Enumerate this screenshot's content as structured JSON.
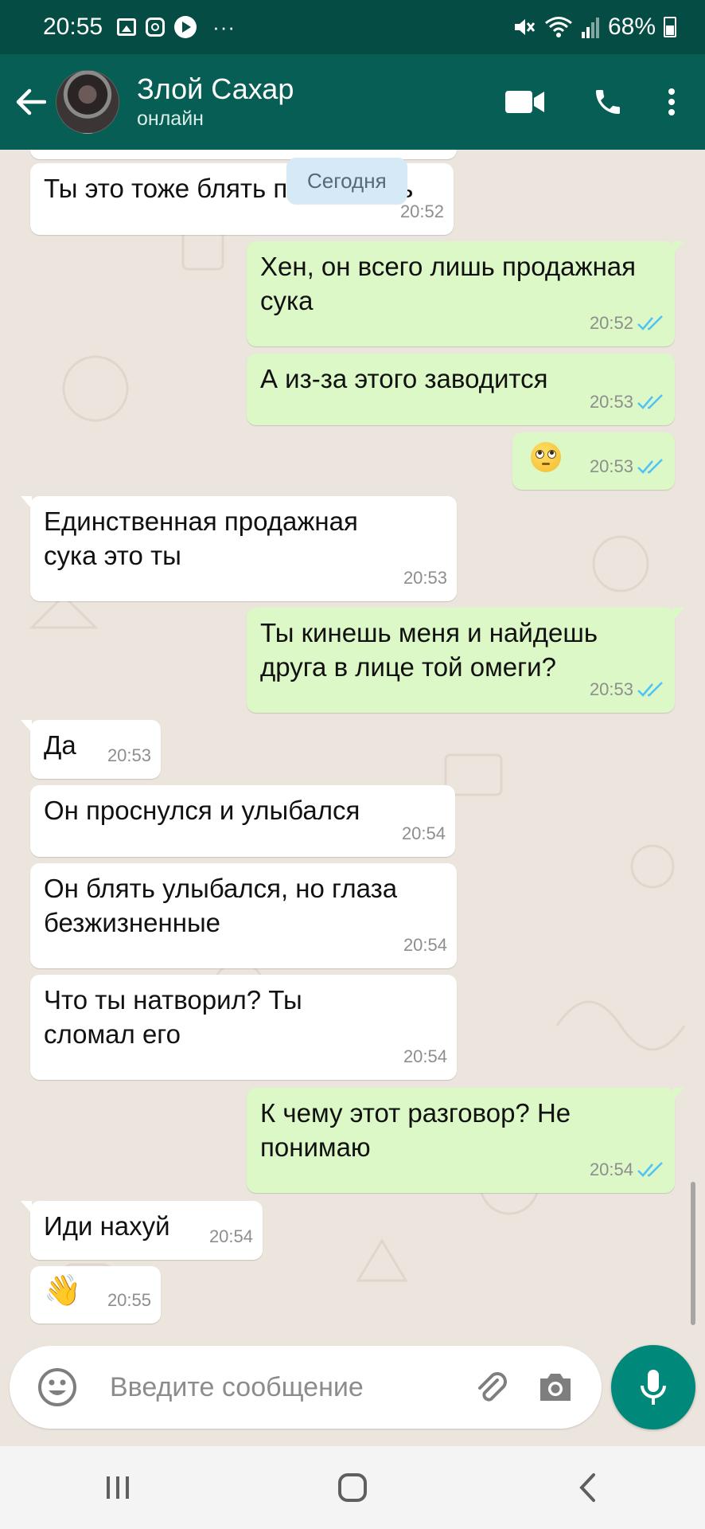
{
  "status_bar": {
    "time": "20:55",
    "battery": "68%",
    "more": "···",
    "icons": [
      "gallery-icon",
      "instagram-icon",
      "play-icon",
      "mute-icon",
      "wifi-icon",
      "signal-icon",
      "battery-icon"
    ]
  },
  "header": {
    "contact_name": "Злой Сахар",
    "status": "онлайн",
    "actions": [
      "video-call-icon",
      "phone-call-icon",
      "more-vert-icon"
    ]
  },
  "chat": {
    "date_chip": "Сегодня",
    "messages": [
      {
        "direction": "in",
        "text": "Ты это тоже блять понимаешь",
        "time": "20:52"
      },
      {
        "direction": "out",
        "text": "Хен, он всего лишь продажная сука",
        "time": "20:52",
        "read": true
      },
      {
        "direction": "out",
        "text": "А из-за этого заводится",
        "time": "20:53",
        "read": true
      },
      {
        "direction": "out",
        "text": "",
        "emoji": "face-with-rolling-eyes",
        "time": "20:53",
        "read": true
      },
      {
        "direction": "in",
        "text": "Единственная продажная сука это ты",
        "time": "20:53"
      },
      {
        "direction": "out",
        "text": "Ты кинешь меня и найдешь друга в лице той омеги?",
        "time": "20:53",
        "read": true
      },
      {
        "direction": "in",
        "text": "Да",
        "time": "20:53"
      },
      {
        "direction": "in",
        "text": "Он проснулся и улыбался",
        "time": "20:54"
      },
      {
        "direction": "in",
        "text": "Он блять улыбался, но глаза безжизненные",
        "time": "20:54"
      },
      {
        "direction": "in",
        "text": "Что ты натворил? Ты сломал его",
        "time": "20:54"
      },
      {
        "direction": "out",
        "text": "К чему этот разговор? Не понимаю",
        "time": "20:54",
        "read": true
      },
      {
        "direction": "in",
        "text": "Иди нахуй",
        "time": "20:54"
      },
      {
        "direction": "in",
        "text": "",
        "emoji": "waving-hand",
        "time": "20:55"
      }
    ]
  },
  "input": {
    "placeholder": "Введите сообщение"
  },
  "colors": {
    "status_bar": "#054d44",
    "app_bar": "#075e54",
    "chat_bg": "#ece5dd",
    "incoming": "#ffffff",
    "outgoing": "#dcf8c6",
    "accent": "#00897b",
    "read_ticks": "#4fc3f7"
  }
}
